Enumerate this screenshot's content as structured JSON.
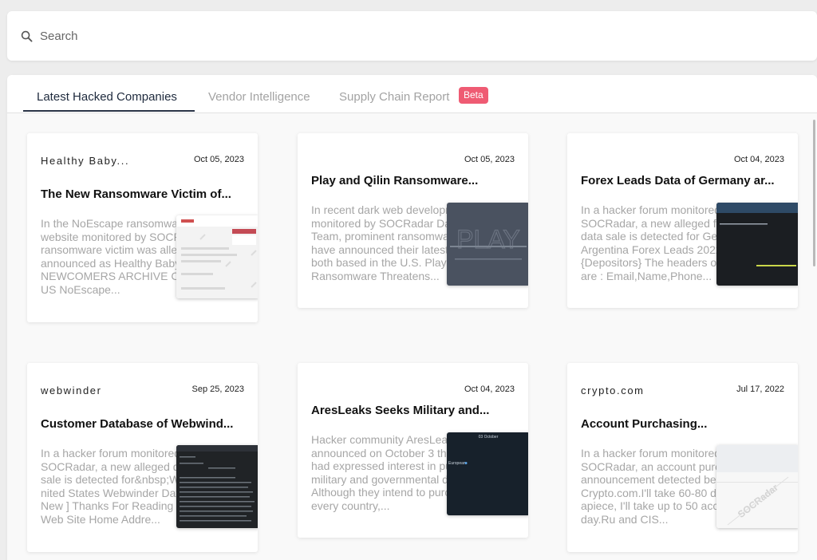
{
  "search": {
    "placeholder": "Search"
  },
  "tabs": [
    {
      "label": "Latest Hacked Companies"
    },
    {
      "label": "Vendor Intelligence"
    },
    {
      "label": "Supply Chain Report",
      "badge": "Beta"
    }
  ],
  "cards": [
    {
      "source": "Healthy Baby...",
      "date": "Oct 05, 2023",
      "title": "The New Ransomware Victim of...",
      "excerpt": "In the NoEscape ransomware group website monitored by SOCRadar, a new ransomware victim was allegedly announced as Healthy Baby Essentials. NEWCOMERS ARCHIVE CONTACT US NoEscape...",
      "thumb": "website-screenshot"
    },
    {
      "source": "",
      "date": "Oct 05, 2023",
      "title": "Play and Qilin Ransomware...",
      "excerpt": "In recent dark web developments monitored by SOCRadar Dark Web Team, prominent ransomware groups have announced their latest victims, both based in the U.S. Play Ransomware Threatens...",
      "thumb": "play-leak-site"
    },
    {
      "source": "",
      "date": "Oct 04, 2023",
      "title": "Forex Leads Data of Germany ar...",
      "excerpt": "In a hacker forum monitored by SOCRadar, a new alleged forex leads data sale is detected for Germany. 30k Argentina Forex Leads 2022 {Depositors} The headers of the leads are : Email,Name,Phone...",
      "thumb": "terminal-dark"
    },
    {
      "source": "webwinder",
      "date": "Sep 25, 2023",
      "title": "Customer Database of Webwind...",
      "excerpt": "In a hacker forum monitored by SOCRadar, a new alleged database sale is detected for&nbsp;Webwinder. nited States Webwinder Database [ New ] Thanks For Reading & Enjoy ! Web Site Home Addre...",
      "thumb": "forum-dark"
    },
    {
      "source": "",
      "date": "Oct 04, 2023",
      "title": "AresLeaks Seeks Military and...",
      "excerpt": "Hacker community AresLeaks announced on October 3 that the group had expressed interest in purchasing military and governmental data. Although they intend to purchase from every country,...",
      "thumb": "chat-dark"
    },
    {
      "source": "crypto.com",
      "date": "Jul 17, 2022",
      "title": "Account Purchasing...",
      "excerpt": "In a hacker forum monitored by SOCRadar, an account purchasing announcement detected belonging to Crypto.com.I'll take 60-80 dollars apiece, I'll take up to 50 accounts a day.Ru and CIS...",
      "thumb": "socradar-watermark"
    }
  ],
  "thumb_text": {
    "play_logo": "PLAY",
    "chat_header": "03 October",
    "chat_sender": "European",
    "watermark": "SOCRadar"
  },
  "colors": {
    "accent": "#2a3447",
    "beta": "#ef5b73",
    "excerpt": "#a6a6a6"
  }
}
